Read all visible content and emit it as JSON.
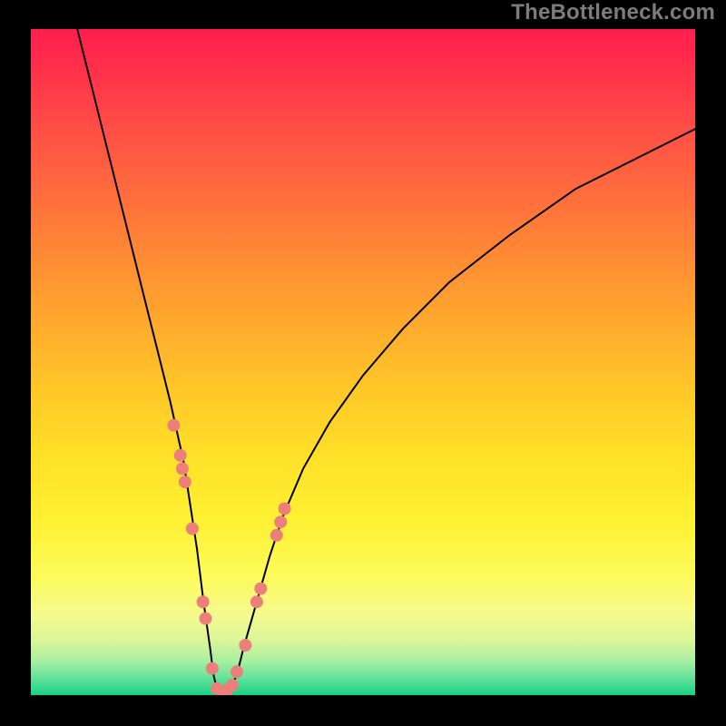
{
  "watermark": "TheBottleneck.com",
  "chart_data": {
    "type": "line",
    "title": "",
    "xlabel": "",
    "ylabel": "",
    "xlim": [
      0,
      100
    ],
    "ylim": [
      0,
      100
    ],
    "background_gradient_top_color": "#ff1e4e",
    "background_gradient_bottom_color": "#18cf7e",
    "series": [
      {
        "name": "bottleneck-curve",
        "color": "#000000",
        "x": [
          7,
          9,
          11,
          13,
          15,
          17,
          19,
          21,
          23,
          25,
          26,
          27,
          27.5,
          28,
          28.5,
          29,
          30,
          31,
          32,
          34,
          36,
          38,
          41,
          45,
          50,
          56,
          63,
          72,
          82,
          92,
          100
        ],
        "y": [
          100,
          92,
          84,
          76,
          68,
          60,
          52,
          44,
          35,
          22,
          14,
          7,
          3,
          1,
          0.5,
          0.5,
          1,
          3,
          7,
          14,
          21,
          27,
          34,
          41,
          48,
          55,
          62,
          69,
          76,
          81,
          85
        ]
      }
    ],
    "points_overlay": {
      "name": "scatter-dots",
      "color": "#ed7f7b",
      "radius_px": 7,
      "x": [
        21.5,
        22.5,
        22.8,
        23.2,
        24.3,
        25.9,
        26.3,
        27.3,
        28.0,
        28.8,
        29.5,
        30.3,
        31.0,
        32.3,
        34.0,
        34.6,
        37.0,
        37.6,
        38.2
      ],
      "y": [
        40.5,
        36,
        34,
        32,
        25,
        14,
        11.5,
        4,
        1,
        0.5,
        0.7,
        1.5,
        3.5,
        7.5,
        14,
        16,
        24,
        26,
        28
      ]
    }
  }
}
